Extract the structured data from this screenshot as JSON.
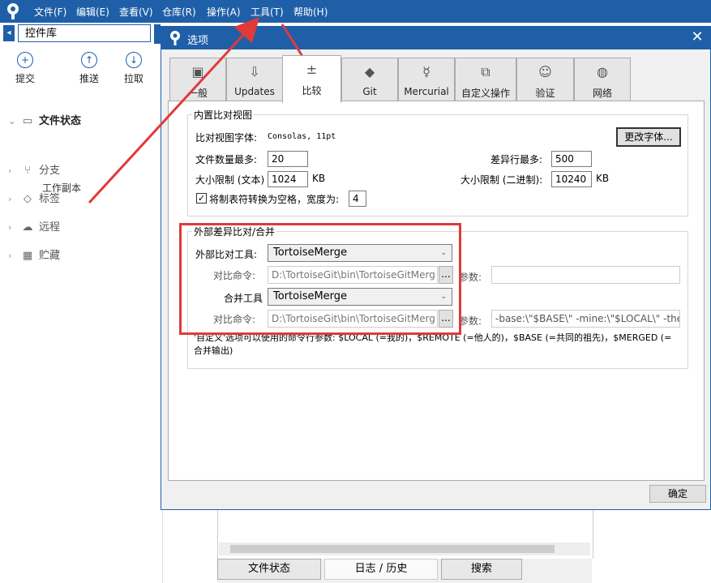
{
  "menubar": {
    "items": [
      "文件(F)",
      "编辑(E)",
      "查看(V)",
      "仓库(R)",
      "操作(A)",
      "工具(T)",
      "帮助(H)"
    ]
  },
  "repo": {
    "name": "控件库"
  },
  "toolbar": {
    "commit": "提交",
    "push": "推送",
    "pull": "拉取"
  },
  "nav": {
    "file_status": "文件状态",
    "working_copy": "工作副本",
    "branches": "分支",
    "tags": "标签",
    "remotes": "远程",
    "stashes": "贮藏"
  },
  "bottom_tabs": [
    "文件状态",
    "日志 / 历史",
    "搜索"
  ],
  "dialog": {
    "title": "选项",
    "close": "✕",
    "tabs": [
      "一般",
      "Updates",
      "比较",
      "Git",
      "Mercurial",
      "自定义操作",
      "验证",
      "网络"
    ],
    "active_tab": "比较",
    "builtin": {
      "title": "内置比对视图",
      "font_label": "比对视图字体:",
      "font_value": "Consolas, 11pt",
      "change_font": "更改字体...",
      "max_files_label": "文件数量最多:",
      "max_files": "20",
      "max_diff_lines_label": "差异行最多:",
      "max_diff_lines": "500",
      "size_text_label": "大小限制 (文本)",
      "size_text": "1024",
      "size_text_unit": "KB",
      "size_bin_label": "大小限制 (二进制):",
      "size_bin": "10240",
      "size_bin_unit": "KB",
      "tabs_label": "将制表符转换为空格，宽度为:",
      "tabs_checked": true,
      "tabs_width": "4"
    },
    "external": {
      "title": "外部差异比对/合并",
      "diff_tool_label": "外部比对工具:",
      "diff_tool": "TortoiseMerge",
      "diff_cmd_label": "对比命令:",
      "diff_cmd": "D:\\TortoiseGit\\bin\\TortoiseGitMerg",
      "diff_args_label": "参数:",
      "diff_args": "",
      "merge_tool_label": "合并工具",
      "merge_tool": "TortoiseMerge",
      "merge_cmd_label": "对比命令:",
      "merge_cmd": "D:\\TortoiseGit\\bin\\TortoiseGitMerg",
      "merge_args_label": "参数:",
      "merge_args": "-base:\\\"$BASE\\\" -mine:\\\"$LOCAL\\\" -the",
      "browse": "...",
      "hint": "'自定义'选项可以使用的命令行参数: $LOCAL (=我的)，$REMOTE (=他人的)，$BASE (=共同的祖先)，$MERGED (=合并输出)"
    },
    "ok": "确定"
  },
  "colors": {
    "accent": "#1f5fa8",
    "annotation": "#e03a3a"
  }
}
